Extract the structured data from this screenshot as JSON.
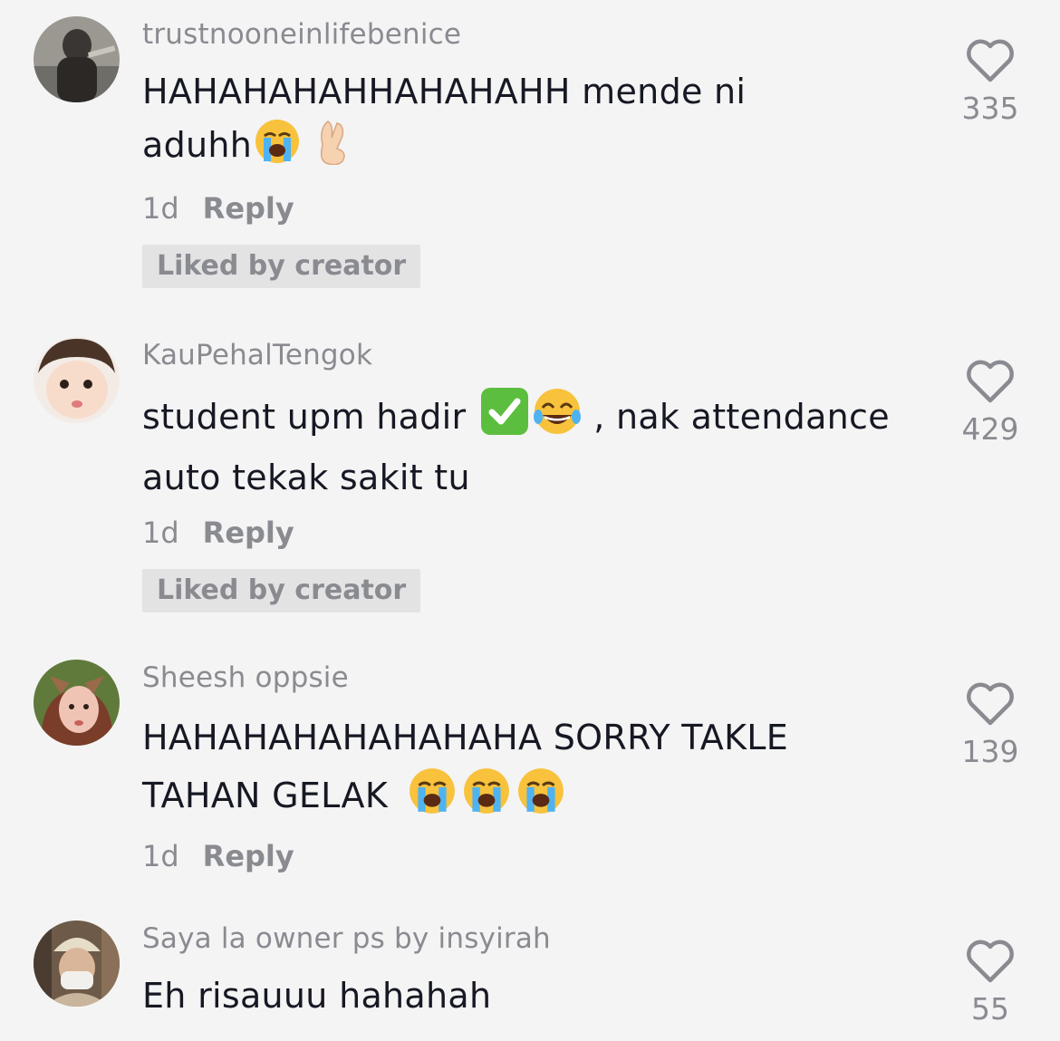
{
  "comments": [
    {
      "username": "trustnooneinlifebenice",
      "text_line1": "HAHAHAHAHHAHAHAHH mende ni",
      "text_line2": "aduhh",
      "time": "1d",
      "reply": "Reply",
      "liked_by_creator": "Liked by creator",
      "likes": "335",
      "emojis": [
        "loudly-crying-face",
        "crossed-fingers"
      ]
    },
    {
      "username": "KauPehalTengok",
      "text_before": "student upm hadir",
      "text_after": ", nak attendance",
      "text_line2": "auto tekak sakit tu",
      "time": "1d",
      "reply": "Reply",
      "liked_by_creator": "Liked by creator",
      "likes": "429",
      "emojis": [
        "check-mark-button",
        "face-with-tears-of-joy"
      ]
    },
    {
      "username": "Sheesh oppsie",
      "text_line1": "HAHAHAHAHAHAHAHA SORRY TAKLE",
      "text_line2": "TAHAN GELAK",
      "time": "1d",
      "reply": "Reply",
      "likes": "139",
      "emojis": [
        "loudly-crying-face",
        "loudly-crying-face",
        "loudly-crying-face"
      ]
    },
    {
      "username": "Saya la owner ps by insyirah",
      "text_line1": "Eh risauuu hahahah",
      "likes": "55"
    }
  ],
  "icons": {
    "like": "heart-outline-icon"
  },
  "colors": {
    "background": "#f4f4f4",
    "muted": "#8a8b91",
    "text": "#161823",
    "badge": "#e3e3e4"
  }
}
